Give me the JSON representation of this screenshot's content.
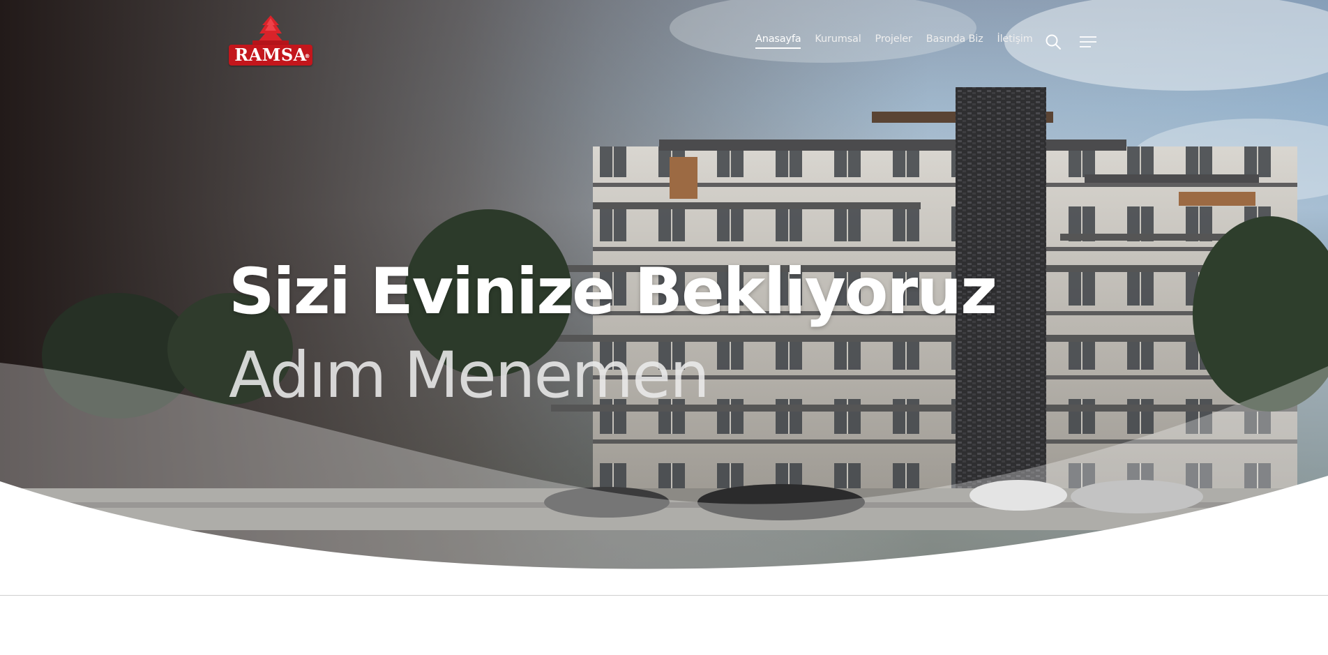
{
  "brand": {
    "logo_text": "RAMSA",
    "registered_mark": "®",
    "brand_color": "#c3161c"
  },
  "nav": {
    "items": [
      {
        "label": "Anasayfa",
        "active": true
      },
      {
        "label": "Kurumsal",
        "active": false
      },
      {
        "label": "Projeler",
        "active": false
      },
      {
        "label": "Basında Biz",
        "active": false
      },
      {
        "label": "İletişim",
        "active": false
      }
    ]
  },
  "header_icons": {
    "search": "search-icon",
    "menu": "hamburger-menu-icon"
  },
  "hero": {
    "headline": "Sizi Evinize Bekliyoruz",
    "subheadline": "Adım Menemen",
    "headline_color": "#ffffff"
  }
}
